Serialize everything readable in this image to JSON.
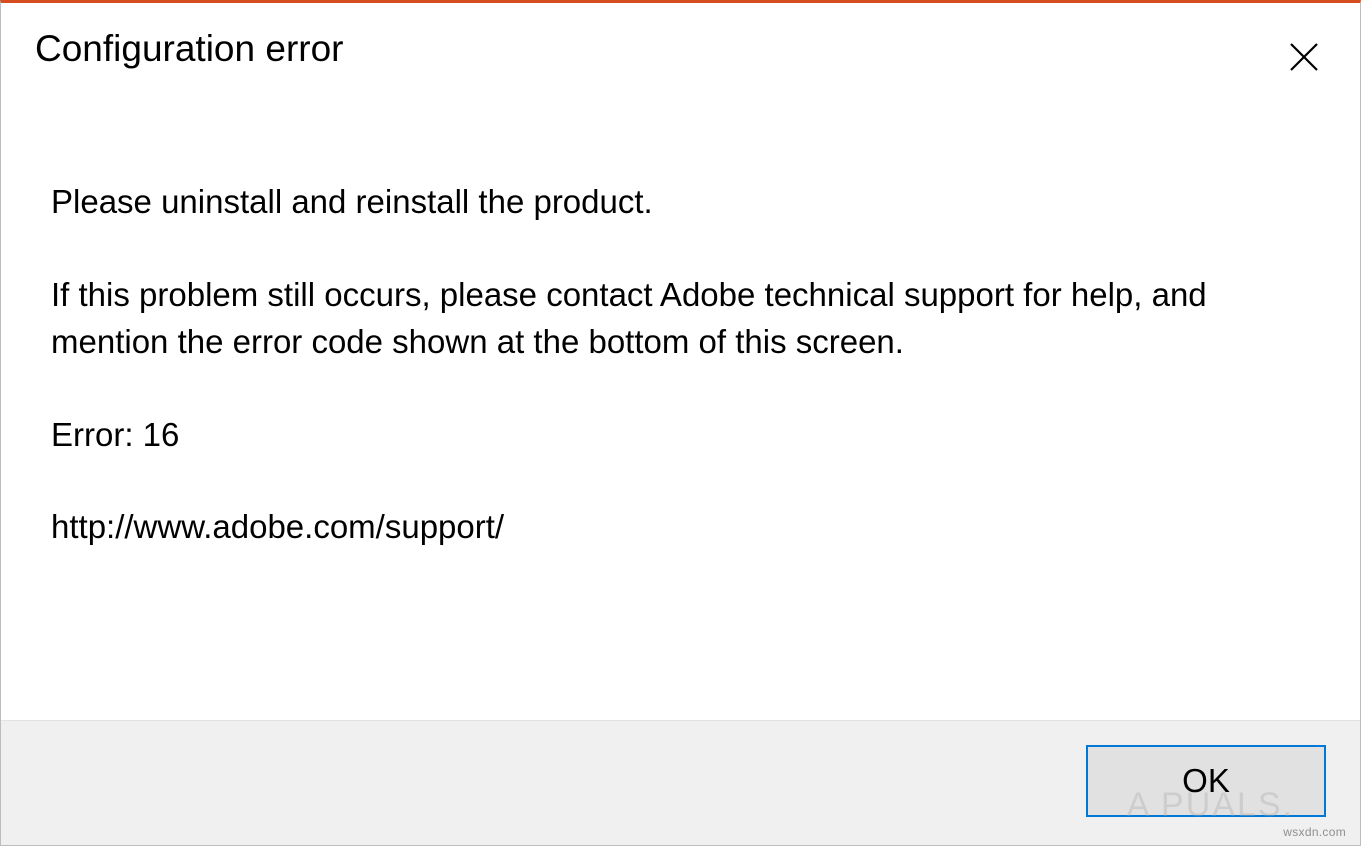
{
  "dialog": {
    "title": "Configuration error",
    "body": {
      "line1": "Please uninstall and reinstall the product.",
      "line2": "If this problem still occurs, please contact Adobe technical support for help, and mention the error code shown at the bottom of this screen.",
      "error_code": "Error: 16",
      "support_url": "http://www.adobe.com/support/"
    },
    "buttons": {
      "ok": "OK"
    }
  },
  "watermark": {
    "logo_text": "A   PUALS.",
    "site": "wsxdn.com"
  }
}
